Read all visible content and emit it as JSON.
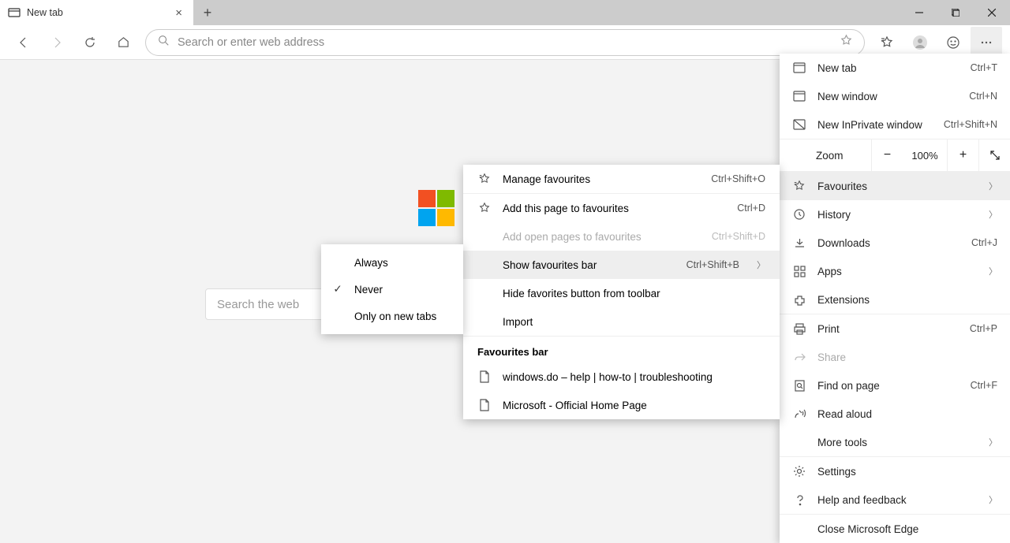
{
  "tab": {
    "title": "New tab"
  },
  "omnibox": {
    "placeholder": "Search or enter web address"
  },
  "page": {
    "search_placeholder": "Search the web"
  },
  "menu": {
    "new_tab": "New tab",
    "new_tab_sc": "Ctrl+T",
    "new_window": "New window",
    "new_window_sc": "Ctrl+N",
    "inprivate": "New InPrivate window",
    "inprivate_sc": "Ctrl+Shift+N",
    "zoom": "Zoom",
    "zoom_value": "100%",
    "favourites": "Favourites",
    "history": "History",
    "downloads": "Downloads",
    "downloads_sc": "Ctrl+J",
    "apps": "Apps",
    "extensions": "Extensions",
    "print": "Print",
    "print_sc": "Ctrl+P",
    "share": "Share",
    "find": "Find on page",
    "find_sc": "Ctrl+F",
    "read_aloud": "Read aloud",
    "more_tools": "More tools",
    "settings": "Settings",
    "help": "Help and feedback",
    "close_edge": "Close Microsoft Edge"
  },
  "fav_submenu": {
    "manage": "Manage favourites",
    "manage_sc": "Ctrl+Shift+O",
    "add_page": "Add this page to favourites",
    "add_page_sc": "Ctrl+D",
    "add_open": "Add open pages to favourites",
    "add_open_sc": "Ctrl+Shift+D",
    "show_bar": "Show favourites bar",
    "show_bar_sc": "Ctrl+Shift+B",
    "hide_btn": "Hide favorites button from toolbar",
    "import": "Import",
    "bar_header": "Favourites bar",
    "fav1": "windows.do – help | how-to | troubleshooting",
    "fav2": "Microsoft - Official Home Page"
  },
  "showbar_flyout": {
    "always": "Always",
    "never": "Never",
    "only_new": "Only on new tabs"
  }
}
